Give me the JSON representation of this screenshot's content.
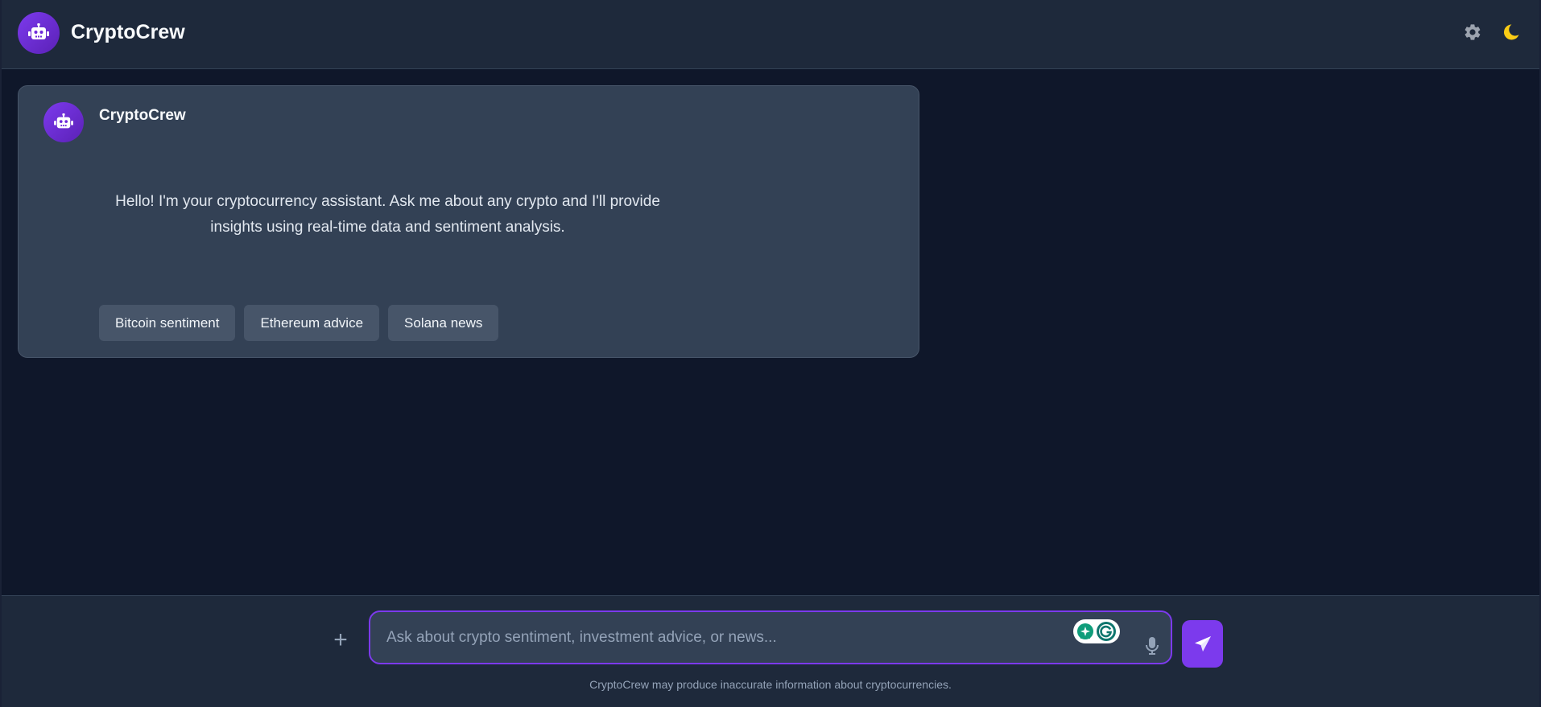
{
  "header": {
    "title": "CryptoCrew",
    "logo_icon": "robot-icon",
    "settings_icon": "gear-icon",
    "theme_icon": "moon-icon"
  },
  "message": {
    "sender": "CryptoCrew",
    "avatar_icon": "robot-icon",
    "text": "Hello! I'm your cryptocurrency assistant. Ask me about any crypto and I'll provide insights using real-time data and sentiment analysis.",
    "suggestions": [
      "Bitcoin sentiment",
      "Ethereum advice",
      "Solana news"
    ]
  },
  "composer": {
    "attach_label": "+",
    "placeholder": "Ask about crypto sentiment, investment advice, or news...",
    "value": "",
    "mic_icon": "microphone-icon",
    "send_icon": "paper-plane-icon"
  },
  "footer": {
    "disclaimer": "CryptoCrew may produce inaccurate information about cryptocurrencies."
  },
  "colors": {
    "accent": "#7c3aed",
    "background": "#0f172a",
    "surface": "#1e293b",
    "card": "#334155",
    "moon": "#facc15"
  }
}
